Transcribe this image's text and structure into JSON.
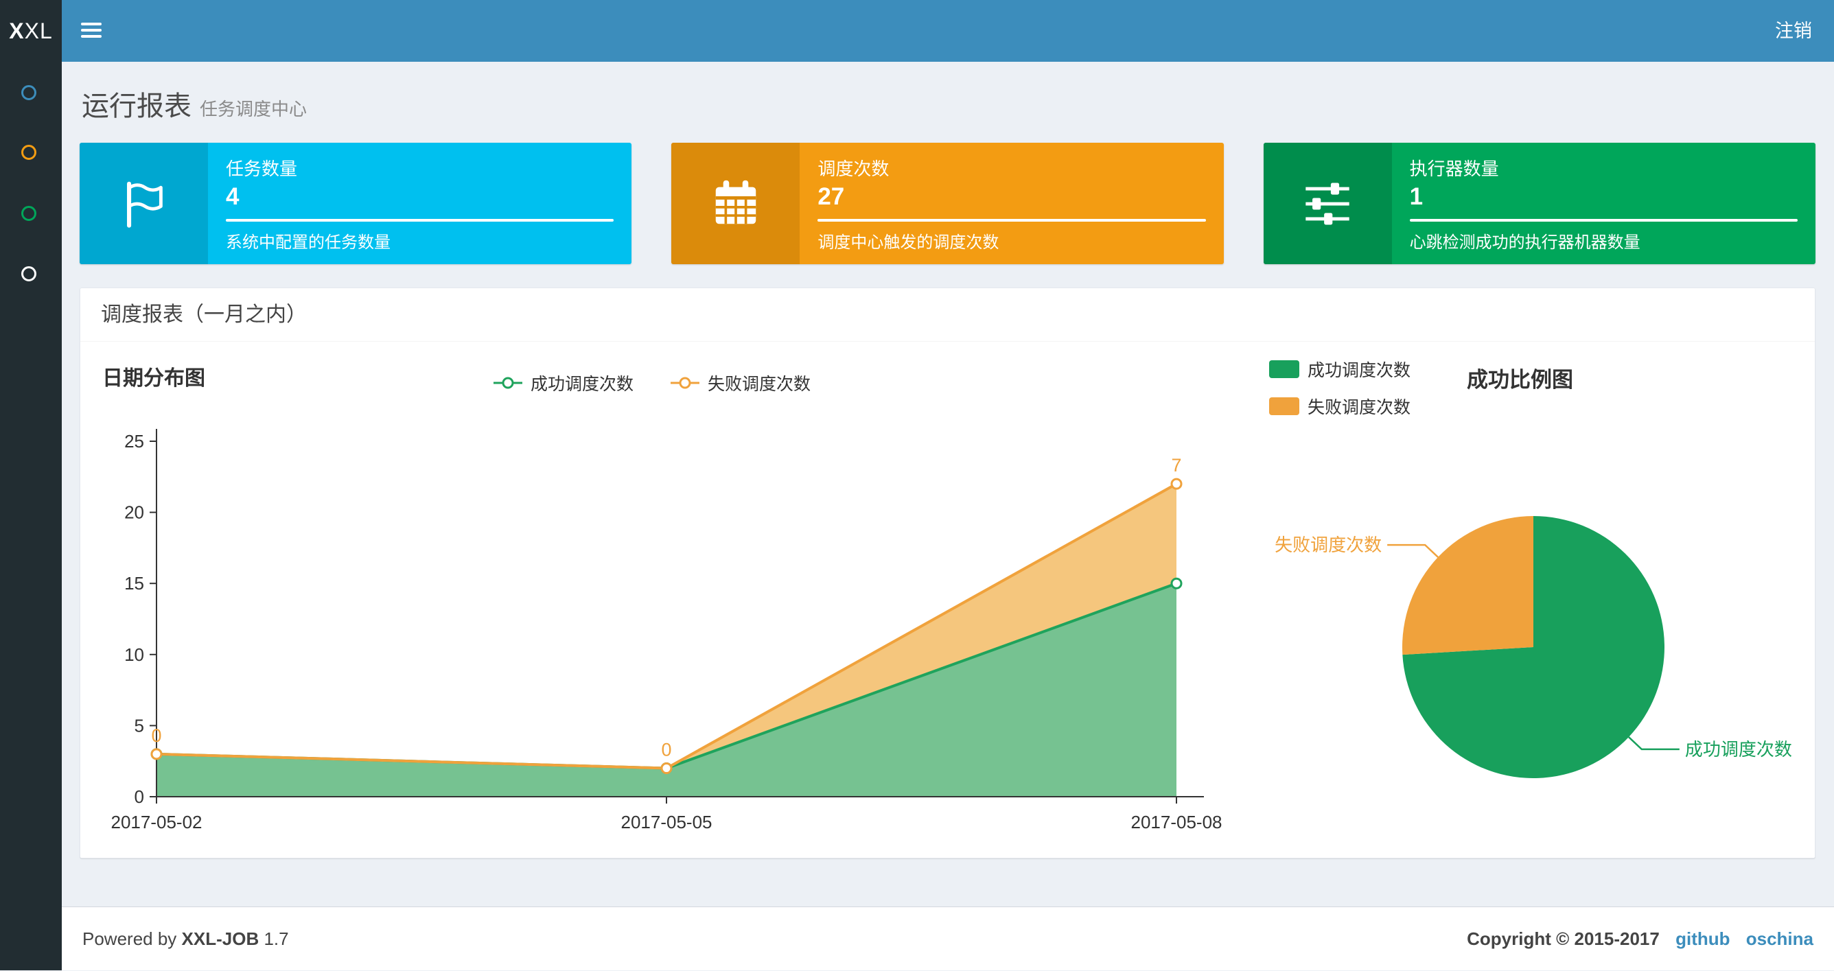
{
  "navbar": {
    "logo_bold": "X",
    "logo_light": "XL",
    "logout_label": "注销"
  },
  "sidebar": {
    "items": [
      {
        "label": "menu-item-1",
        "color": "#3c8dbc"
      },
      {
        "label": "menu-item-2",
        "color": "#f39c12"
      },
      {
        "label": "menu-item-3",
        "color": "#00a65a"
      },
      {
        "label": "menu-item-4",
        "color": "#ffffff"
      }
    ]
  },
  "header": {
    "title": "运行报表",
    "subtitle": "任务调度中心"
  },
  "info_boxes": [
    {
      "icon": "flag-icon",
      "title": "任务数量",
      "number": "4",
      "description": "系统中配置的任务数量",
      "bg": "#00c0ef",
      "icon_bg": "#00a7d0"
    },
    {
      "icon": "calendar-icon",
      "title": "调度次数",
      "number": "27",
      "description": "调度中心触发的调度次数",
      "bg": "#f39c12",
      "icon_bg": "#db8b0b"
    },
    {
      "icon": "sliders-icon",
      "title": "执行器数量",
      "number": "1",
      "description": "心跳检测成功的执行器机器数量",
      "bg": "#00a65a",
      "icon_bg": "#008d4c"
    }
  ],
  "panel": {
    "title": "调度报表（一月之内）"
  },
  "chart_data": [
    {
      "type": "area",
      "title": "日期分布图",
      "categories": [
        "2017-05-02",
        "2017-05-05",
        "2017-05-08"
      ],
      "series": [
        {
          "name": "成功调度次数",
          "values": [
            3,
            2,
            15
          ],
          "color": "#1fa35c",
          "fill": "#6fbf8b"
        },
        {
          "name": "失败调度次数",
          "values": [
            0,
            0,
            7
          ],
          "color": "#f0a23c",
          "fill": "#f4c376"
        }
      ],
      "stacked": true,
      "ylim": [
        0,
        25
      ],
      "ytick_step": 5,
      "point_labels": {
        "series": "失败调度次数",
        "values": [
          "0",
          "0",
          "7"
        ]
      },
      "legend_position": "top-center",
      "grid": false
    },
    {
      "type": "pie",
      "title": "成功比例图",
      "slices": [
        {
          "name": "成功调度次数",
          "value": 20,
          "color": "#18a05c"
        },
        {
          "name": "失败调度次数",
          "value": 7,
          "color": "#f0a23c"
        }
      ],
      "legend_position": "top-left"
    }
  ],
  "footer": {
    "powered_prefix": "Powered by",
    "product": "XXL-JOB",
    "version": "1.7",
    "copyright": "Copyright © 2015-2017",
    "links": [
      {
        "label": "github"
      },
      {
        "label": "oschina"
      }
    ]
  }
}
